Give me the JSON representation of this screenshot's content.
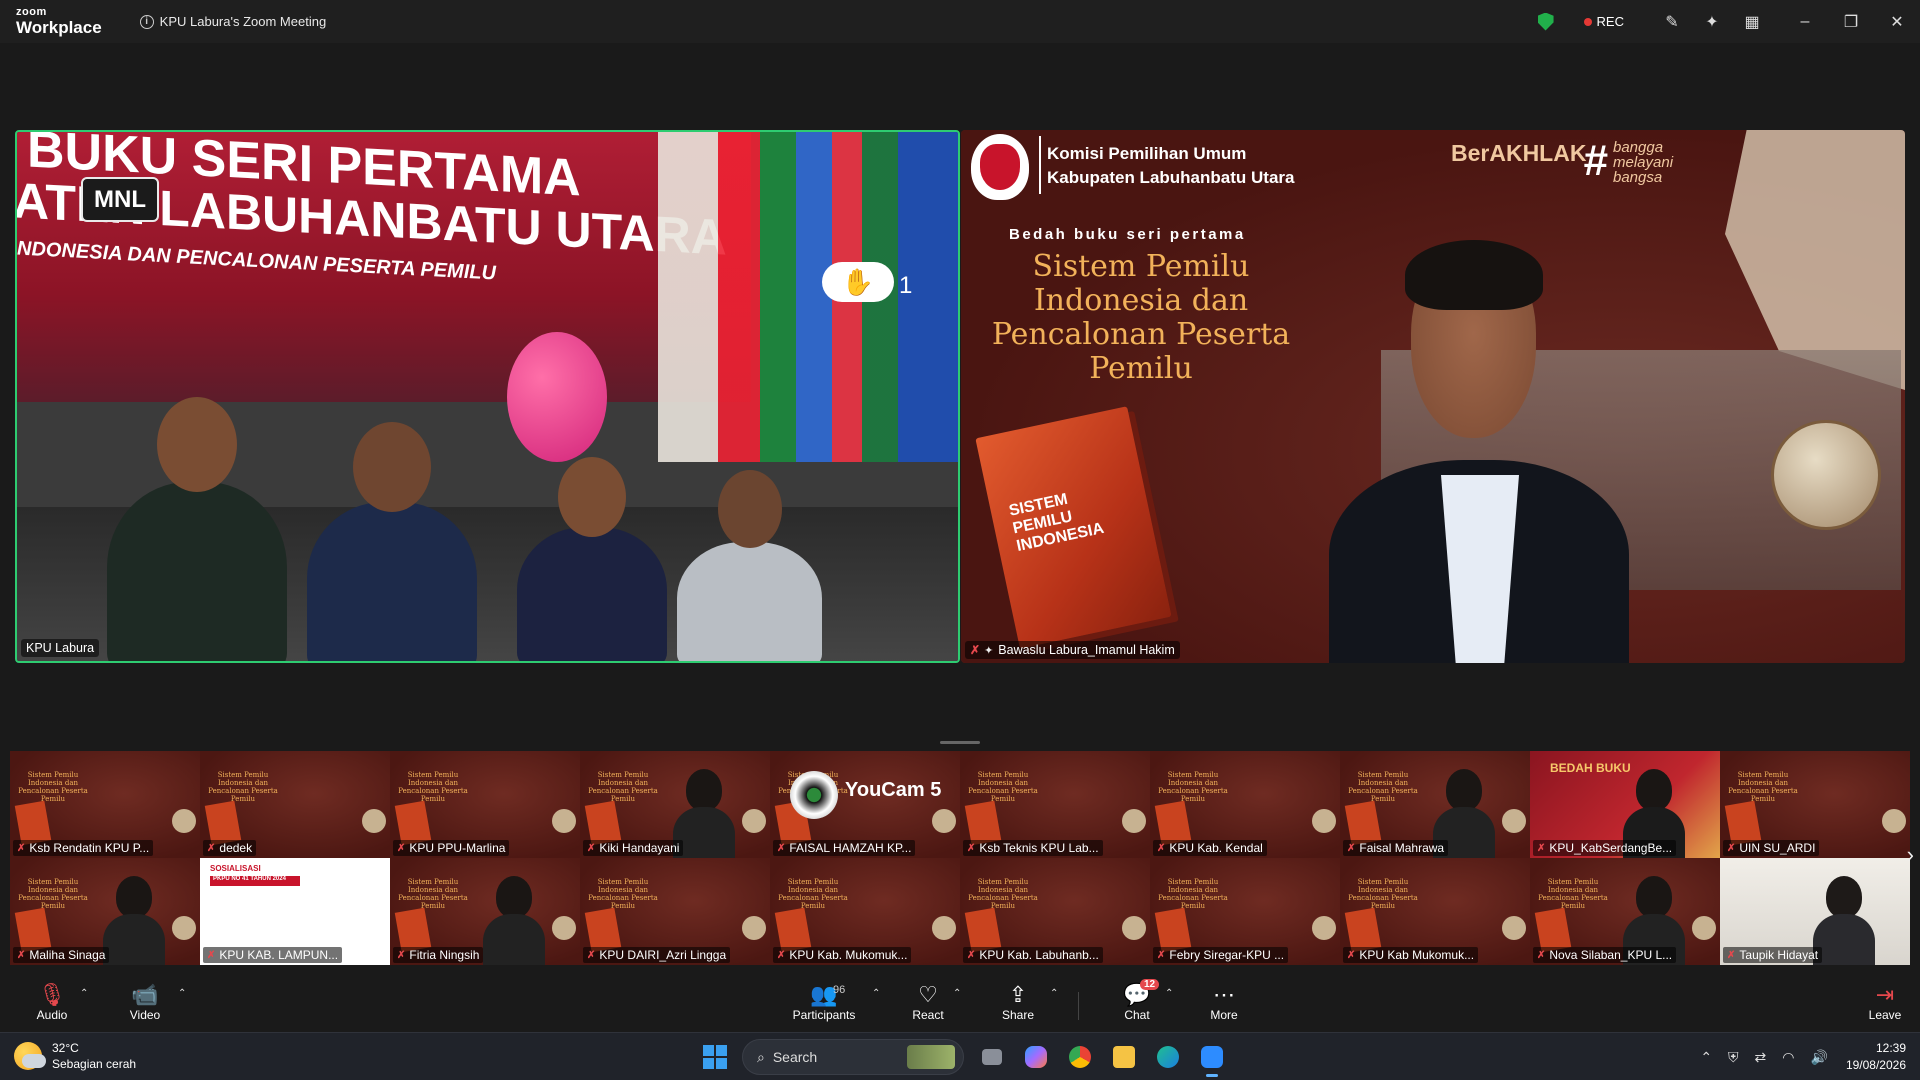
{
  "titlebar": {
    "brand_top": "zoom",
    "brand_bottom": "Workplace",
    "meeting_title": "KPU Labura's Zoom Meeting",
    "rec_label": "REC"
  },
  "main_videos": {
    "left": {
      "name": "KPU Labura",
      "banner_line1": "BUKU SERI PERTAMA",
      "banner_line2": "ATEN LABUHANBATU UTARA",
      "banner_line3": "NDONESIA DAN PENCALONAN PESERTA PEMILU",
      "logo_overlay": "MNL",
      "raise_hand_count": "1"
    },
    "right": {
      "name": "Bawaslu Labura_Imamul Hakim",
      "org_line1": "Komisi Pemilihan Umum",
      "org_line2": "Kabupaten Labuhanbatu Utara",
      "berakhlak": "BerAKHLAK",
      "hashtag_line1": "bangga",
      "hashtag_line2": "melayani",
      "hashtag_line3": "bangsa",
      "kicker": "Bedah buku seri pertama",
      "title": "Sistem Pemilu Indonesia dan Pencalonan Peserta Pemilu",
      "book_text": "SISTEM PEMILU INDONESIA"
    }
  },
  "gallery": {
    "mini_slide_title": "Sistem Pemilu Indonesia dan Pencalonan Peserta Pemilu",
    "sosialisasi": "SOSIALISASI",
    "pkpu": "PKPU NO 41 TAHUN 2024",
    "youcam": "YouCam 5",
    "bedah_buku": "BEDAH BUKU",
    "participants": [
      {
        "name": "Ksb Rendatin KPU P..."
      },
      {
        "name": "dedek"
      },
      {
        "name": "KPU PPU-Marlina"
      },
      {
        "name": "Kiki Handayani"
      },
      {
        "name": "FAISAL HAMZAH KP..."
      },
      {
        "name": "Ksb Teknis KPU  Lab..."
      },
      {
        "name": "KPU Kab. Kendal"
      },
      {
        "name": "Faisal Mahrawa"
      },
      {
        "name": "KPU_KabSerdangBe..."
      },
      {
        "name": "UIN SU_ARDI"
      },
      {
        "name": "Maliha Sinaga"
      },
      {
        "name": "KPU KAB. LAMPUN..."
      },
      {
        "name": "Fitria Ningsih"
      },
      {
        "name": "KPU DAIRI_Azri Lingga"
      },
      {
        "name": "KPU Kab. Mukomuk..."
      },
      {
        "name": "KPU Kab. Labuhanb..."
      },
      {
        "name": "Febry Siregar-KPU ..."
      },
      {
        "name": "KPU Kab Mukomuk..."
      },
      {
        "name": "Nova Silaban_KPU L..."
      },
      {
        "name": "Taupik Hidayat"
      }
    ]
  },
  "toolbar": {
    "audio": "Audio",
    "video": "Video",
    "participants": "Participants",
    "participants_count": "96",
    "react": "React",
    "share": "Share",
    "chat": "Chat",
    "chat_badge": "12",
    "more": "More",
    "leave": "Leave"
  },
  "taskbar": {
    "temp": "32°C",
    "weather": "Sebagian cerah",
    "search": "Search",
    "time": "12:39",
    "date": "19/08/2026"
  },
  "colors": {
    "active_speaker_border": "#2ecc71",
    "mic_off": "#e5484d",
    "rec": "#e53935",
    "shield": "#21b04b"
  }
}
